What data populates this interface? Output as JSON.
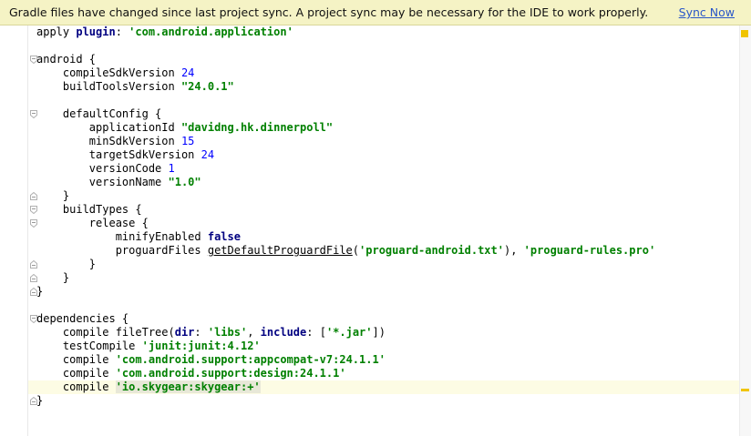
{
  "banner": {
    "message": "Gradle files have changed since last project sync. A project sync may be necessary for the IDE to work properly.",
    "sync_label": "Sync Now"
  },
  "editor": {
    "lines": [
      {
        "seg": [
          {
            "t": "apply "
          },
          {
            "t": "plugin",
            "c": "kw"
          },
          {
            "t": ": "
          },
          {
            "t": "'com.android.application'",
            "c": "str"
          }
        ]
      },
      {
        "seg": []
      },
      {
        "seg": [
          {
            "t": "android {"
          }
        ]
      },
      {
        "seg": [
          {
            "t": "    compileSdkVersion "
          },
          {
            "t": "24",
            "c": "num"
          }
        ]
      },
      {
        "seg": [
          {
            "t": "    buildToolsVersion "
          },
          {
            "t": "\"24.0.1\"",
            "c": "str"
          }
        ]
      },
      {
        "seg": []
      },
      {
        "seg": [
          {
            "t": "    defaultConfig {"
          }
        ]
      },
      {
        "seg": [
          {
            "t": "        applicationId "
          },
          {
            "t": "\"davidng.hk.dinnerpoll\"",
            "c": "str"
          }
        ]
      },
      {
        "seg": [
          {
            "t": "        minSdkVersion "
          },
          {
            "t": "15",
            "c": "num"
          }
        ]
      },
      {
        "seg": [
          {
            "t": "        targetSdkVersion "
          },
          {
            "t": "24",
            "c": "num"
          }
        ]
      },
      {
        "seg": [
          {
            "t": "        versionCode "
          },
          {
            "t": "1",
            "c": "num"
          }
        ]
      },
      {
        "seg": [
          {
            "t": "        versionName "
          },
          {
            "t": "\"1.0\"",
            "c": "str"
          }
        ]
      },
      {
        "seg": [
          {
            "t": "    }"
          }
        ]
      },
      {
        "seg": [
          {
            "t": "    buildTypes {"
          }
        ]
      },
      {
        "seg": [
          {
            "t": "        release {"
          }
        ]
      },
      {
        "seg": [
          {
            "t": "            minifyEnabled "
          },
          {
            "t": "false",
            "c": "kw"
          }
        ]
      },
      {
        "seg": [
          {
            "t": "            proguardFiles "
          },
          {
            "t": "getDefaultProguardFile",
            "c": "fn"
          },
          {
            "t": "("
          },
          {
            "t": "'proguard-android.txt'",
            "c": "str"
          },
          {
            "t": "), "
          },
          {
            "t": "'proguard-rules.pro'",
            "c": "str"
          }
        ]
      },
      {
        "seg": [
          {
            "t": "        }"
          }
        ]
      },
      {
        "seg": [
          {
            "t": "    }"
          }
        ]
      },
      {
        "seg": [
          {
            "t": "}"
          }
        ]
      },
      {
        "seg": []
      },
      {
        "seg": [
          {
            "t": "dependencies {"
          }
        ]
      },
      {
        "seg": [
          {
            "t": "    compile fileTree("
          },
          {
            "t": "dir",
            "c": "kw"
          },
          {
            "t": ": "
          },
          {
            "t": "'libs'",
            "c": "str"
          },
          {
            "t": ", "
          },
          {
            "t": "include",
            "c": "kw"
          },
          {
            "t": ": ["
          },
          {
            "t": "'*.jar'",
            "c": "str"
          },
          {
            "t": "])"
          }
        ]
      },
      {
        "seg": [
          {
            "t": "    testCompile "
          },
          {
            "t": "'junit:junit:4.12'",
            "c": "str"
          }
        ]
      },
      {
        "seg": [
          {
            "t": "    compile "
          },
          {
            "t": "'com.android.support:appcompat-v7:24.1.1'",
            "c": "str"
          }
        ]
      },
      {
        "seg": [
          {
            "t": "    compile "
          },
          {
            "t": "'com.android.support:design:24.1.1'",
            "c": "str"
          }
        ]
      },
      {
        "seg": [
          {
            "t": "    compile "
          },
          {
            "t": "'io.skygear:skygear:+'",
            "c": "str hl"
          }
        ]
      },
      {
        "seg": [
          {
            "t": "}"
          }
        ]
      }
    ]
  },
  "colors": {
    "banner_bg": "#f5f3c5",
    "link": "#2a57c8",
    "keyword": "#000080",
    "string": "#008000",
    "number": "#0000ff",
    "warning_marker": "#f0c400"
  }
}
